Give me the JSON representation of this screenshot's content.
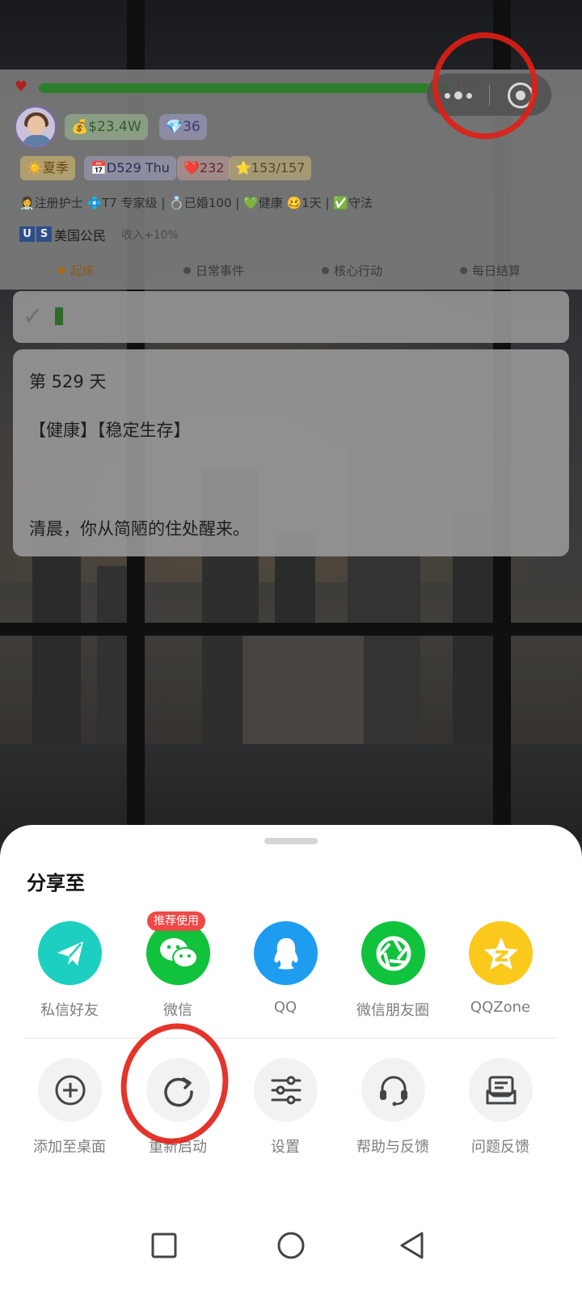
{
  "status": {
    "hp_progress": 0.96,
    "hp_value": "100",
    "money": "💰$23.4W",
    "gems": "💎36",
    "season": "☀️夏季",
    "day": "📅D529 Thu",
    "health": "❤️232",
    "stars": "⭐153/157",
    "profile_line": "👩‍⚕️注册护士 💠T7 专家级 | 💍已婚100 | 💚健康 🥴1天 | ✅守法",
    "flag": [
      "U",
      "S"
    ],
    "citizenship": "美国公民",
    "income_bonus": "收入+10%"
  },
  "phases": [
    "起床",
    "日常事件",
    "核心行动",
    "每日结算"
  ],
  "story": {
    "day_title": "第 529 天",
    "tags": "【健康】【稳定生存】",
    "text": "清晨，你从简陋的住处醒来。"
  },
  "sheet": {
    "title": "分享至",
    "badge": "推荐使用",
    "share_options": [
      "私信好友",
      "微信",
      "QQ",
      "微信朋友圈",
      "QQZone"
    ],
    "action_options": [
      "添加至桌面",
      "重新启动",
      "设置",
      "帮助与反馈",
      "问题反馈"
    ]
  },
  "colors": {
    "private_message": "#1ccfc0",
    "wechat": "#10c23c",
    "qq": "#1e9df0",
    "moments": "#10c23c",
    "qzone": "#fbc81c",
    "annotation": "#e11e14"
  }
}
